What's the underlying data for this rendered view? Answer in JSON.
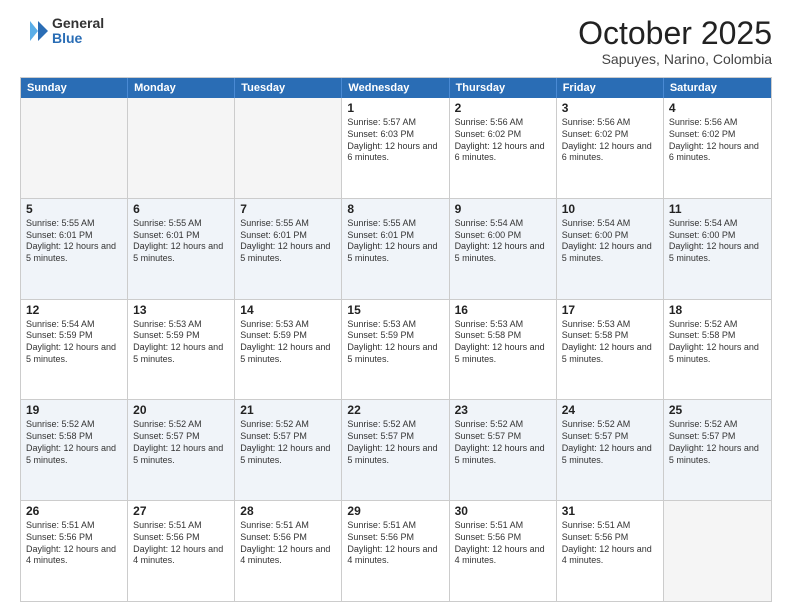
{
  "logo": {
    "general": "General",
    "blue": "Blue"
  },
  "header": {
    "month": "October 2025",
    "location": "Sapuyes, Narino, Colombia"
  },
  "days": [
    "Sunday",
    "Monday",
    "Tuesday",
    "Wednesday",
    "Thursday",
    "Friday",
    "Saturday"
  ],
  "rows": [
    [
      {
        "day": "",
        "text": ""
      },
      {
        "day": "",
        "text": ""
      },
      {
        "day": "",
        "text": ""
      },
      {
        "day": "1",
        "text": "Sunrise: 5:57 AM\nSunset: 6:03 PM\nDaylight: 12 hours and 6 minutes."
      },
      {
        "day": "2",
        "text": "Sunrise: 5:56 AM\nSunset: 6:02 PM\nDaylight: 12 hours and 6 minutes."
      },
      {
        "day": "3",
        "text": "Sunrise: 5:56 AM\nSunset: 6:02 PM\nDaylight: 12 hours and 6 minutes."
      },
      {
        "day": "4",
        "text": "Sunrise: 5:56 AM\nSunset: 6:02 PM\nDaylight: 12 hours and 6 minutes."
      }
    ],
    [
      {
        "day": "5",
        "text": "Sunrise: 5:55 AM\nSunset: 6:01 PM\nDaylight: 12 hours and 5 minutes."
      },
      {
        "day": "6",
        "text": "Sunrise: 5:55 AM\nSunset: 6:01 PM\nDaylight: 12 hours and 5 minutes."
      },
      {
        "day": "7",
        "text": "Sunrise: 5:55 AM\nSunset: 6:01 PM\nDaylight: 12 hours and 5 minutes."
      },
      {
        "day": "8",
        "text": "Sunrise: 5:55 AM\nSunset: 6:01 PM\nDaylight: 12 hours and 5 minutes."
      },
      {
        "day": "9",
        "text": "Sunrise: 5:54 AM\nSunset: 6:00 PM\nDaylight: 12 hours and 5 minutes."
      },
      {
        "day": "10",
        "text": "Sunrise: 5:54 AM\nSunset: 6:00 PM\nDaylight: 12 hours and 5 minutes."
      },
      {
        "day": "11",
        "text": "Sunrise: 5:54 AM\nSunset: 6:00 PM\nDaylight: 12 hours and 5 minutes."
      }
    ],
    [
      {
        "day": "12",
        "text": "Sunrise: 5:54 AM\nSunset: 5:59 PM\nDaylight: 12 hours and 5 minutes."
      },
      {
        "day": "13",
        "text": "Sunrise: 5:53 AM\nSunset: 5:59 PM\nDaylight: 12 hours and 5 minutes."
      },
      {
        "day": "14",
        "text": "Sunrise: 5:53 AM\nSunset: 5:59 PM\nDaylight: 12 hours and 5 minutes."
      },
      {
        "day": "15",
        "text": "Sunrise: 5:53 AM\nSunset: 5:59 PM\nDaylight: 12 hours and 5 minutes."
      },
      {
        "day": "16",
        "text": "Sunrise: 5:53 AM\nSunset: 5:58 PM\nDaylight: 12 hours and 5 minutes."
      },
      {
        "day": "17",
        "text": "Sunrise: 5:53 AM\nSunset: 5:58 PM\nDaylight: 12 hours and 5 minutes."
      },
      {
        "day": "18",
        "text": "Sunrise: 5:52 AM\nSunset: 5:58 PM\nDaylight: 12 hours and 5 minutes."
      }
    ],
    [
      {
        "day": "19",
        "text": "Sunrise: 5:52 AM\nSunset: 5:58 PM\nDaylight: 12 hours and 5 minutes."
      },
      {
        "day": "20",
        "text": "Sunrise: 5:52 AM\nSunset: 5:57 PM\nDaylight: 12 hours and 5 minutes."
      },
      {
        "day": "21",
        "text": "Sunrise: 5:52 AM\nSunset: 5:57 PM\nDaylight: 12 hours and 5 minutes."
      },
      {
        "day": "22",
        "text": "Sunrise: 5:52 AM\nSunset: 5:57 PM\nDaylight: 12 hours and 5 minutes."
      },
      {
        "day": "23",
        "text": "Sunrise: 5:52 AM\nSunset: 5:57 PM\nDaylight: 12 hours and 5 minutes."
      },
      {
        "day": "24",
        "text": "Sunrise: 5:52 AM\nSunset: 5:57 PM\nDaylight: 12 hours and 5 minutes."
      },
      {
        "day": "25",
        "text": "Sunrise: 5:52 AM\nSunset: 5:57 PM\nDaylight: 12 hours and 5 minutes."
      }
    ],
    [
      {
        "day": "26",
        "text": "Sunrise: 5:51 AM\nSunset: 5:56 PM\nDaylight: 12 hours and 4 minutes."
      },
      {
        "day": "27",
        "text": "Sunrise: 5:51 AM\nSunset: 5:56 PM\nDaylight: 12 hours and 4 minutes."
      },
      {
        "day": "28",
        "text": "Sunrise: 5:51 AM\nSunset: 5:56 PM\nDaylight: 12 hours and 4 minutes."
      },
      {
        "day": "29",
        "text": "Sunrise: 5:51 AM\nSunset: 5:56 PM\nDaylight: 12 hours and 4 minutes."
      },
      {
        "day": "30",
        "text": "Sunrise: 5:51 AM\nSunset: 5:56 PM\nDaylight: 12 hours and 4 minutes."
      },
      {
        "day": "31",
        "text": "Sunrise: 5:51 AM\nSunset: 5:56 PM\nDaylight: 12 hours and 4 minutes."
      },
      {
        "day": "",
        "text": ""
      }
    ]
  ]
}
